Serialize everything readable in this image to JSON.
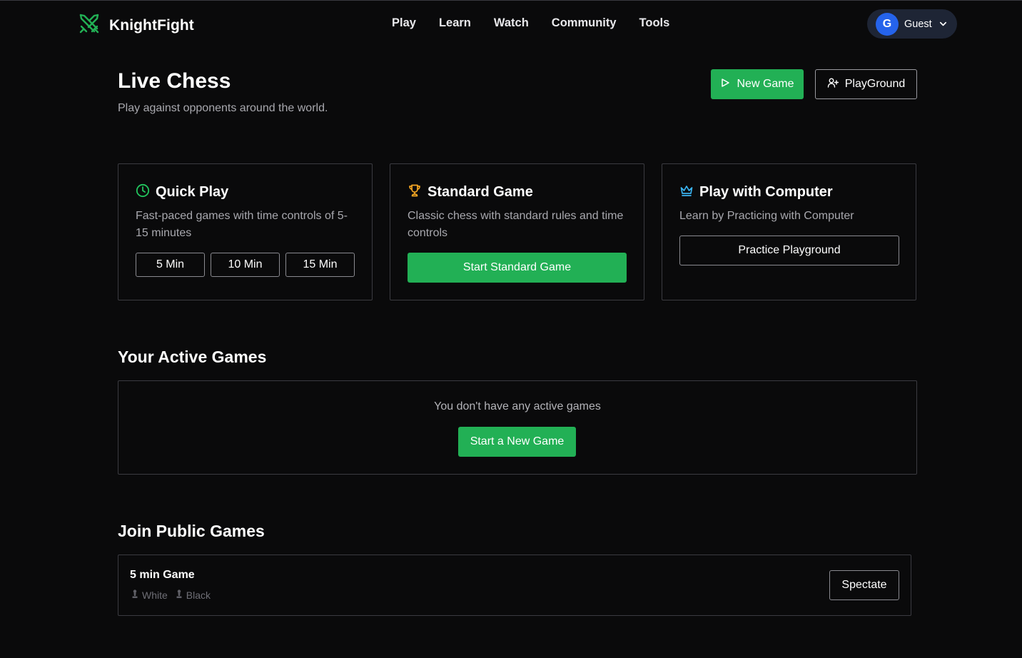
{
  "app": {
    "name": "KnightFight"
  },
  "nav": {
    "links": [
      "Play",
      "Learn",
      "Watch",
      "Community",
      "Tools"
    ]
  },
  "user": {
    "initial": "G",
    "name": "Guest"
  },
  "header": {
    "title": "Live Chess",
    "subtitle": "Play against opponents around the world.",
    "new_game_label": "New Game",
    "playground_label": "PlayGround"
  },
  "cards": {
    "quick_play": {
      "title": "Quick Play",
      "description": "Fast-paced games with time controls of 5-15 minutes",
      "options": [
        "5 Min",
        "10 Min",
        "15 Min"
      ],
      "icon": "clock-icon"
    },
    "standard": {
      "title": "Standard Game",
      "description": "Classic chess with standard rules and time controls",
      "button": "Start Standard Game",
      "icon": "trophy-icon"
    },
    "computer": {
      "title": "Play with Computer",
      "description": "Learn by Practicing with Computer",
      "button": "Practice Playground",
      "icon": "crown-icon"
    }
  },
  "active_games": {
    "title": "Your Active Games",
    "empty_message": "You don't have any active games",
    "button": "Start a New Game"
  },
  "public_games": {
    "title": "Join Public Games",
    "games": [
      {
        "name": "5 min Game",
        "white": "White",
        "black": "Black",
        "action": "Spectate"
      }
    ]
  },
  "colors": {
    "accent_green": "#22b055",
    "avatar_blue": "#2563eb",
    "clock_green": "#22c55e",
    "trophy_amber": "#f5a623",
    "crown_blue": "#3ab4f2"
  }
}
